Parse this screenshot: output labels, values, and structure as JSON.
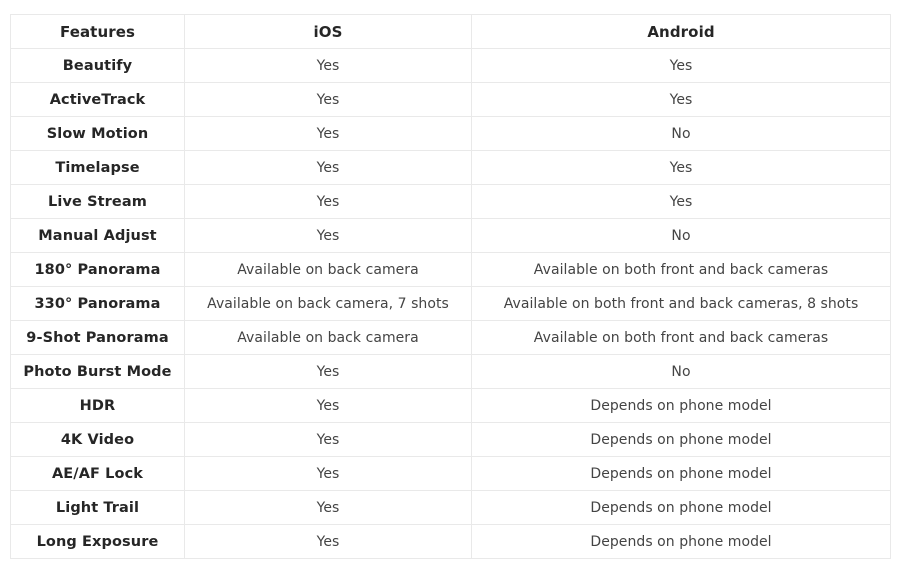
{
  "table": {
    "columns": [
      "Features",
      "iOS",
      "Android"
    ],
    "rows": [
      {
        "feature": "Beautify",
        "ios": "Yes",
        "android": "Yes"
      },
      {
        "feature": "ActiveTrack",
        "ios": "Yes",
        "android": "Yes"
      },
      {
        "feature": "Slow Motion",
        "ios": "Yes",
        "android": "No"
      },
      {
        "feature": "Timelapse",
        "ios": "Yes",
        "android": "Yes"
      },
      {
        "feature": "Live Stream",
        "ios": "Yes",
        "android": "Yes"
      },
      {
        "feature": "Manual Adjust",
        "ios": "Yes",
        "android": "No"
      },
      {
        "feature": "180° Panorama",
        "ios": "Available on back camera",
        "android": "Available on both front and back cameras"
      },
      {
        "feature": "330° Panorama",
        "ios": "Available on back camera, 7 shots",
        "android": "Available on both front and back cameras, 8 shots"
      },
      {
        "feature": "9-Shot Panorama",
        "ios": "Available on back camera",
        "android": "Available on both front and back cameras"
      },
      {
        "feature": "Photo Burst Mode",
        "ios": "Yes",
        "android": "No"
      },
      {
        "feature": "HDR",
        "ios": "Yes",
        "android": "Depends on phone model"
      },
      {
        "feature": "4K Video",
        "ios": "Yes",
        "android": "Depends on phone model"
      },
      {
        "feature": "AE/AF Lock",
        "ios": "Yes",
        "android": "Depends on phone model"
      },
      {
        "feature": "Light Trail",
        "ios": "Yes",
        "android": "Depends on phone model"
      },
      {
        "feature": "Long Exposure",
        "ios": "Yes",
        "android": "Depends on phone model"
      }
    ]
  },
  "style": {
    "border_color": "#e9e9e9",
    "header_text_color": "#262626",
    "value_text_color": "#444444",
    "background_color": "#ffffff"
  }
}
